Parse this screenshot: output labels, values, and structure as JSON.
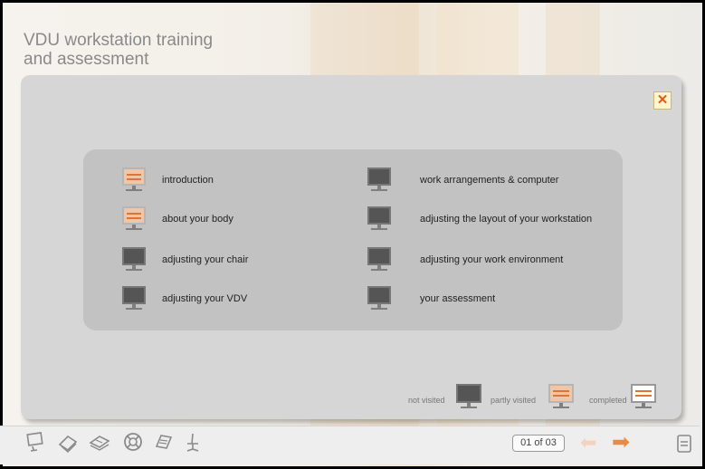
{
  "app": {
    "title_line1": "VDU workstation training",
    "title_line2": "and assessment"
  },
  "dialog": {
    "close_label": "✕"
  },
  "menu": {
    "left": [
      {
        "label": "introduction",
        "status": "partly visited"
      },
      {
        "label": "about your body",
        "status": "partly visited"
      },
      {
        "label": "adjusting your chair",
        "status": "not visited"
      },
      {
        "label": "adjusting your VDV",
        "status": "not visited"
      }
    ],
    "right": [
      {
        "label": "work arrangements & computer",
        "status": "not visited"
      },
      {
        "label": "adjusting the layout of your workstation",
        "status": "not visited"
      },
      {
        "label": "adjusting your work environment",
        "status": "not visited"
      },
      {
        "label": "your assessment",
        "status": "not visited"
      }
    ]
  },
  "legend": {
    "not_visited": "not visited",
    "partly_visited": "partly visited",
    "completed": "completed"
  },
  "toolbar": {
    "icons": [
      "monitor-icon",
      "book-icon",
      "books-icon",
      "lifebuoy-icon",
      "notepad-icon",
      "chair-icon"
    ],
    "page_counter": "01 of 03",
    "back_icon": "arrow-left-icon",
    "next_icon": "arrow-right-icon",
    "print_icon": "printer-icon"
  },
  "colors": {
    "accent": "#e17431",
    "panel": "#d6d6d6",
    "menu_box": "#c2c2c2"
  }
}
